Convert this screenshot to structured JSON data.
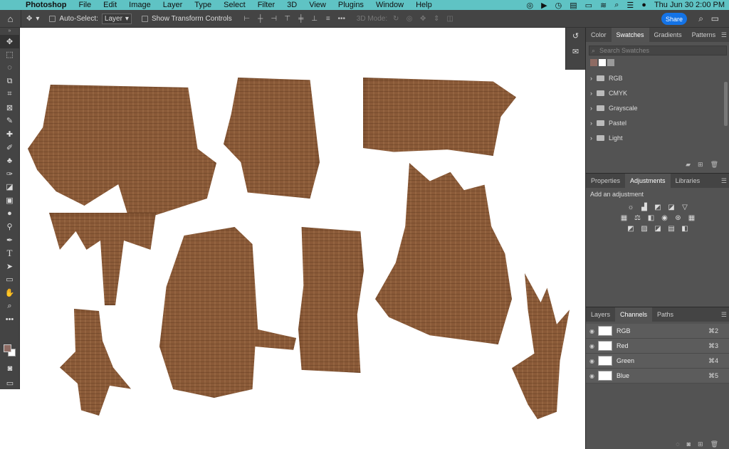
{
  "menubar": {
    "app": "Photoshop",
    "items": [
      "File",
      "Edit",
      "Image",
      "Layer",
      "Type",
      "Select",
      "Filter",
      "3D",
      "View",
      "Plugins",
      "Window",
      "Help"
    ],
    "datetime": "Thu Jun 30  2:00 PM"
  },
  "options": {
    "auto_select_label": "Auto-Select:",
    "auto_select_value": "Layer",
    "show_transform_label": "Show Transform Controls",
    "mode_3d_label": "3D Mode:",
    "share_label": "Share"
  },
  "swatches_panel": {
    "tabs": [
      "Color",
      "Swatches",
      "Gradients",
      "Patterns"
    ],
    "active_tab": "Swatches",
    "search_placeholder": "Search Swatches",
    "recent_colors": [
      "#8e6b63",
      "#ffffff",
      "#9a9a9a"
    ],
    "groups": [
      "RGB",
      "CMYK",
      "Grayscale",
      "Pastel",
      "Light"
    ]
  },
  "adjustments_panel": {
    "tabs": [
      "Properties",
      "Adjustments",
      "Libraries"
    ],
    "active_tab": "Adjustments",
    "add_label": "Add an adjustment"
  },
  "channels_panel": {
    "tabs": [
      "Layers",
      "Channels",
      "Paths"
    ],
    "active_tab": "Channels",
    "channels": [
      {
        "name": "RGB",
        "shortcut": "⌘2"
      },
      {
        "name": "Red",
        "shortcut": "⌘3"
      },
      {
        "name": "Green",
        "shortcut": "⌘4"
      },
      {
        "name": "Blue",
        "shortcut": "⌘5"
      }
    ]
  },
  "colors": {
    "menubar_bg": "#5fc3c4",
    "foreground": "#8e6b63",
    "background": "#ffffff",
    "accent": "#1473e6"
  }
}
